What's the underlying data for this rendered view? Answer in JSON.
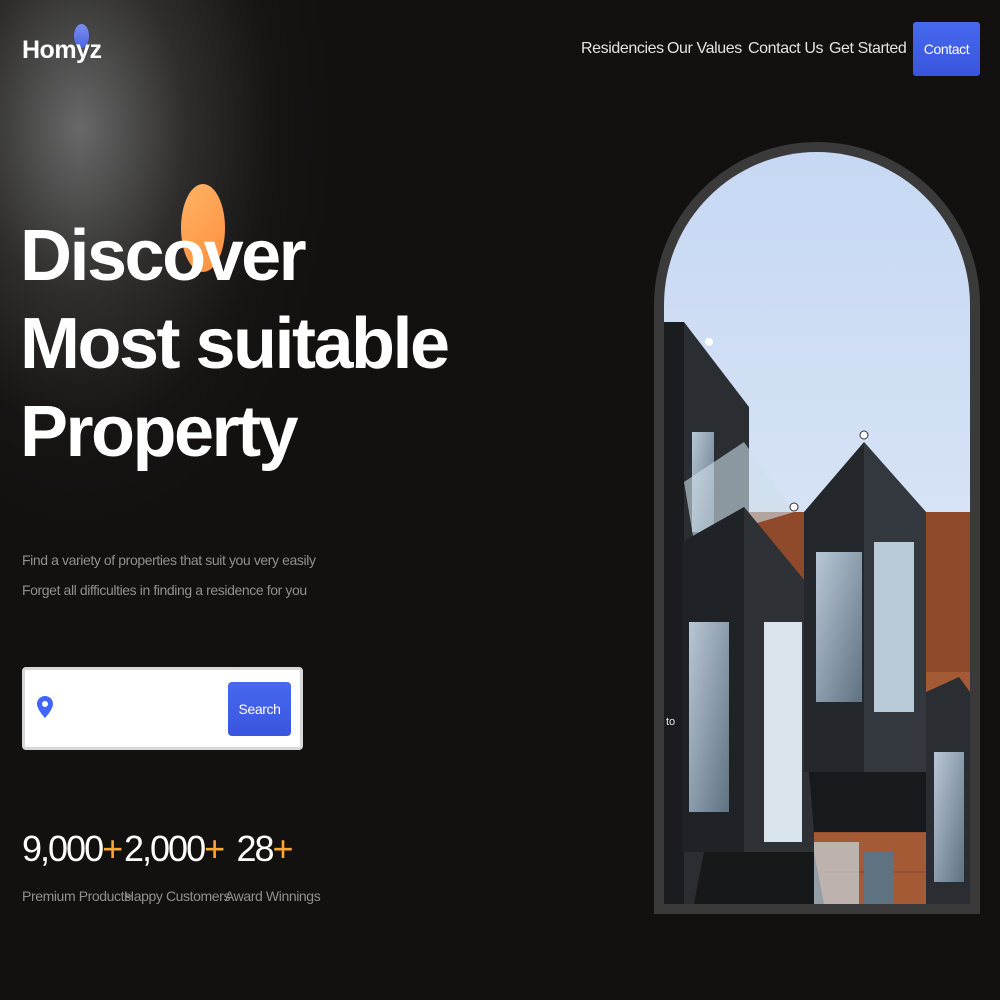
{
  "header": {
    "logo": "Homyz",
    "nav": [
      "Residencies",
      "Our Values",
      "Contact Us",
      "Get Started"
    ],
    "contact_label": "Contact"
  },
  "hero": {
    "title_lines": [
      "Discover",
      "Most suitable",
      "Property"
    ],
    "description_lines": [
      "Find a variety of properties that suit you very easily",
      "Forget all difficulties in finding a residence for you"
    ]
  },
  "search": {
    "placeholder": "",
    "value": "",
    "button_label": "Search"
  },
  "stats": [
    {
      "value": "9,000",
      "suffix": "+",
      "label": "Premium Products"
    },
    {
      "value": "2,000",
      "suffix": "+",
      "label": "Happy Customers"
    },
    {
      "value": "28",
      "suffix": "+",
      "label": "Award Winnings"
    }
  ],
  "image": {
    "caption": "to"
  },
  "colors": {
    "background": "#131110",
    "accent_blue": "#4066ff",
    "accent_orange": "#ffa531",
    "muted_text": "#8f8f8f"
  },
  "icons": {
    "location": "location-pin-icon",
    "logo_mark": "logo-dot-icon",
    "hero_decoration": "orange-circle-decoration"
  }
}
